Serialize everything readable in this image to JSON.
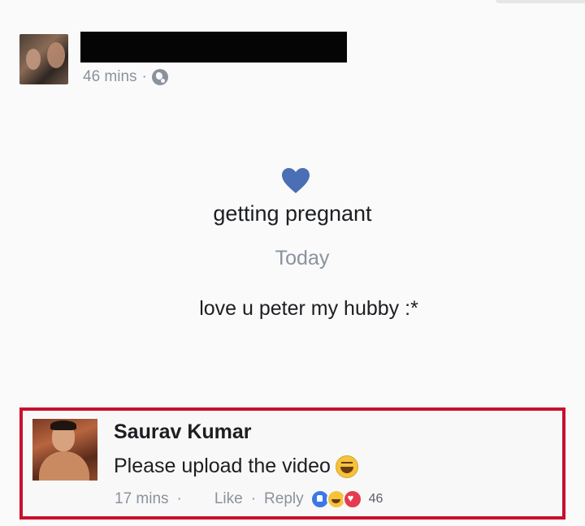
{
  "post": {
    "time": "46 mins",
    "separator": "·",
    "privacy_icon": "globe-icon"
  },
  "life_event": {
    "icon": "heart-icon",
    "icon_color": "#4a6fb5",
    "title": "getting pregnant",
    "date": "Today",
    "caption": "love u peter my hubby :*"
  },
  "comment": {
    "highlight_color": "#c8102e",
    "author": "Saurav Kumar",
    "text": "Please upload the video",
    "emoji": "laughing-face-icon",
    "time": "17 mins",
    "separator": "·",
    "like_label": "Like",
    "reply_label": "Reply",
    "reactions": [
      "like-reaction-icon",
      "haha-reaction-icon",
      "love-reaction-icon"
    ],
    "reaction_count": "46"
  }
}
